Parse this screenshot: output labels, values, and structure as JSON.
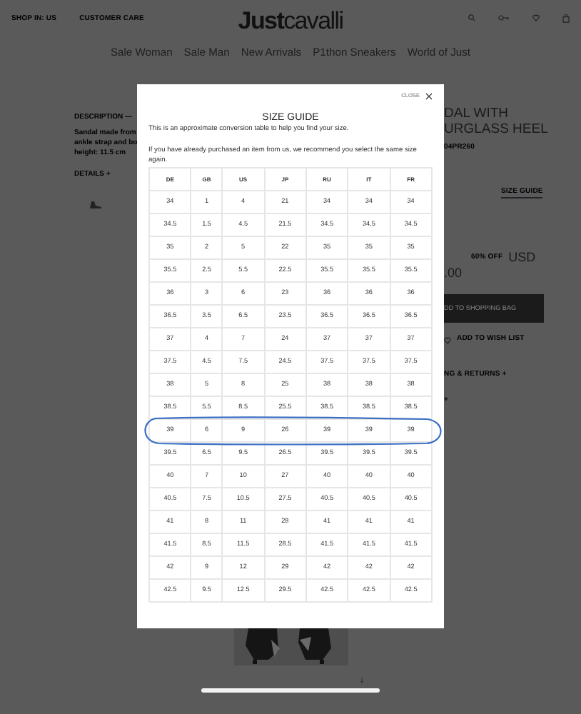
{
  "header": {
    "links": [
      "SHOP IN: US",
      "CUSTOMER CARE"
    ],
    "logo": {
      "bold": "Just",
      "light": "cavalli"
    }
  },
  "nav": [
    "Sale Woman",
    "Sale Man",
    "New Arrivals",
    "P1thon Sneakers",
    "World of Just"
  ],
  "description": {
    "heading": "DESCRIPTION —",
    "lines": [
      "Sandal made from",
      "ankle strap and bo",
      "height: 11.5 cm"
    ],
    "details": "DETAILS +"
  },
  "product": {
    "title_lines": [
      "DAL WITH",
      "URGLASS HEEL"
    ],
    "code": "04PR260",
    "size_guide_link": "SIZE GUIDE",
    "discount": "60% OFF",
    "currency": "USD",
    "price": ".00",
    "add_to_bag": "DD TO SHOPPING BAG",
    "wish_list": "ADD TO WISH LIST",
    "accordions": [
      "NG & RETURNS +",
      "+"
    ]
  },
  "modal": {
    "close": "CLOSE",
    "title": "SIZE GUIDE",
    "intro": "This is an approximate conversion table to help you find your size.",
    "note": "If you have already purchased an item from us, we recommend you select the same size again.",
    "size_table": {
      "columns": [
        "DE",
        "GB",
        "US",
        "JP",
        "RU",
        "IT",
        "FR"
      ],
      "rows": [
        {
          "cells": [
            "34",
            "1",
            "4",
            "21",
            "34",
            "34",
            "34"
          ],
          "circled": false
        },
        {
          "cells": [
            "34.5",
            "1.5",
            "4.5",
            "21.5",
            "34.5",
            "34.5",
            "34.5"
          ],
          "circled": false
        },
        {
          "cells": [
            "35",
            "2",
            "5",
            "22",
            "35",
            "35",
            "35"
          ],
          "circled": false
        },
        {
          "cells": [
            "35.5",
            "2.5",
            "5.5",
            "22.5",
            "35.5",
            "35.5",
            "35.5"
          ],
          "circled": false
        },
        {
          "cells": [
            "36",
            "3",
            "6",
            "23",
            "36",
            "36",
            "36"
          ],
          "circled": false
        },
        {
          "cells": [
            "36.5",
            "3.5",
            "6.5",
            "23.5",
            "36.5",
            "36.5",
            "36.5"
          ],
          "circled": false
        },
        {
          "cells": [
            "37",
            "4",
            "7",
            "24",
            "37",
            "37",
            "37"
          ],
          "circled": false
        },
        {
          "cells": [
            "37.5",
            "4.5",
            "7.5",
            "24.5",
            "37.5",
            "37.5",
            "37.5"
          ],
          "circled": false
        },
        {
          "cells": [
            "38",
            "5",
            "8",
            "25",
            "38",
            "38",
            "38"
          ],
          "circled": false
        },
        {
          "cells": [
            "38.5",
            "5.5",
            "8.5",
            "25.5",
            "38.5",
            "38.5",
            "38.5"
          ],
          "circled": false
        },
        {
          "cells": [
            "39",
            "6",
            "9",
            "26",
            "39",
            "39",
            "39"
          ],
          "circled": true
        },
        {
          "cells": [
            "39.5",
            "6.5",
            "9.5",
            "26.5",
            "39.5",
            "39.5",
            "39.5"
          ],
          "circled": false
        },
        {
          "cells": [
            "40",
            "7",
            "10",
            "27",
            "40",
            "40",
            "40"
          ],
          "circled": false
        },
        {
          "cells": [
            "40.5",
            "7.5",
            "10.5",
            "27.5",
            "40.5",
            "40.5",
            "40.5"
          ],
          "circled": false
        },
        {
          "cells": [
            "41",
            "8",
            "11",
            "28",
            "41",
            "41",
            "41"
          ],
          "circled": false
        },
        {
          "cells": [
            "41.5",
            "8.5",
            "11.5",
            "28.5",
            "41.5",
            "41.5",
            "41.5"
          ],
          "circled": false
        },
        {
          "cells": [
            "42",
            "9",
            "12",
            "29",
            "42",
            "42",
            "42"
          ],
          "circled": false
        },
        {
          "cells": [
            "42.5",
            "9.5",
            "12.5",
            "29.5",
            "42.5",
            "42.5",
            "42.5"
          ],
          "circled": false
        }
      ]
    }
  },
  "scroll_arrow": "↓"
}
